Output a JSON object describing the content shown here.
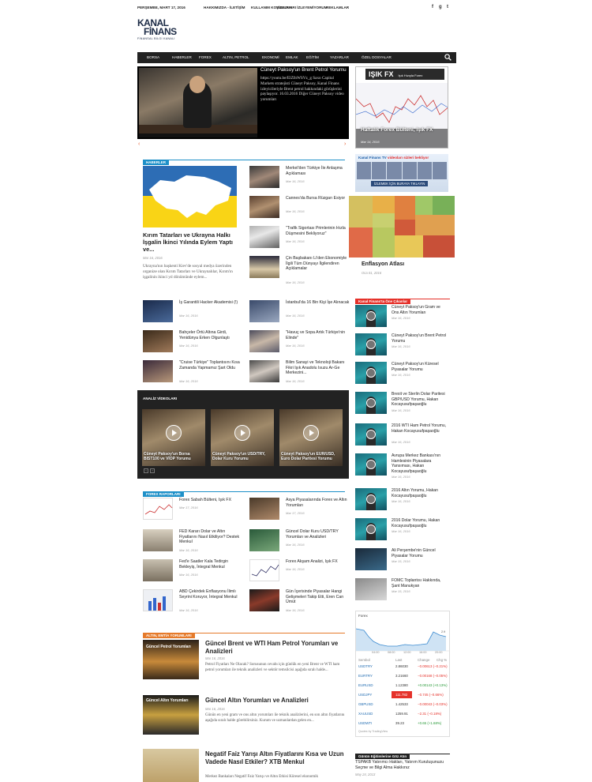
{
  "topbar": {
    "date": "PERŞEMBE, MART 17, 2016",
    "links": [
      "HAKKIMIZDA - İLETİŞİM",
      "KULLANIM KOŞULLARI",
      "VİDEOLARI İZLEYEMİYORUM",
      "REKLAMLAR"
    ]
  },
  "logo": {
    "line1": "KANAL",
    "line2": "FİNANS",
    "tagline": "FİNANSAL BİLGİ KANALI"
  },
  "nav": {
    "items": [
      "BORSA",
      "HABERLER",
      "FOREX",
      "ALTIN, PETROL",
      "EKONOMİ",
      "EMLAK",
      "EĞİTİM",
      "YAZARLAR",
      "ÖZEL DOSYALAR"
    ]
  },
  "slider": {
    "title": "Cüneyt Paksoy'un Brent Petrol Yorumu",
    "excerpt": "https://youtu.be/ElZfnWSVz_g Saxo Capital Markets stratejisti Cüneyt Paksoy, Kanal Finans izleyicileriyle Brent petrol hakkındaki görüşlerini paylaşıyor. 16.03.2016 Diğer Cüneyt Paksoy video yorumları"
  },
  "sidebar_top": {
    "fx_logo": "IŞIK FX",
    "fx_tag": "Işık Hızıyla Forex",
    "fx_caption": "Haftalık Forex Bülteni, Işık FX",
    "fx_date": "Mar 14, 2016",
    "promo_head_1": "Kanal Finans TV",
    "promo_head_2": "videoları sizleri bekliyor",
    "promo_cta": "İZLEMEK İÇİN BURAYA TIKLAYIN",
    "treemap_title": "Enflasyon Atlası",
    "treemap_date": "Oca 01, 2016"
  },
  "news": {
    "label": "HABERLER",
    "big_img_tag": "ukraine",
    "big_title": "Kırım Tatarları ve Ukrayna Halkı İşgalin İkinci Yılında Eylem Yaptı ve...",
    "big_date": "Mar 16, 2016",
    "big_excerpt": "Ukrayna'nın başkenti Kiev'de sosyal medya üzerinden organize olan Kırım Tatarları ve Ukraynalılar, Kırım'ın işgalinin ikinci yıl dönümünde eylem...",
    "right": [
      {
        "title": "Merkel'den Türkiye İle Anlaşma Açıklaması",
        "date": "Mar 16, 2016"
      },
      {
        "title": "Cannes'da Bursa Rüzgarı Esiyor",
        "date": "Mar 16, 2016"
      },
      {
        "title": "\"Trafik Sigortası Primlerinin Hızla Düşmesini Bekliyoruz\"",
        "date": "Mar 16, 2016"
      },
      {
        "title": "Çin Başbakanı Li'den Ekonomiyle İlgili Tüm Dünyayı İlgilendiren Açıklamalar",
        "date": "Mar 16, 2016"
      }
    ],
    "grid": [
      {
        "title": "İş Garantili Hacker Akademisi (!)",
        "date": "Mar 16, 2016"
      },
      {
        "title": "İstanbul'da 16 Bin Kişi İşe Alınacak",
        "date": "Mar 16, 2016"
      },
      {
        "title": "Bahçeler Örtü Altına Girdi, Yenidünya Erken Olgunlaştı",
        "date": "Mar 16, 2016"
      },
      {
        "title": "\"Havuç ve Sopa Artık Türkiye'nin Elinde\"",
        "date": "Mar 16, 2016"
      },
      {
        "title": "\"Cruise Türkiye\" Toplantısını Kısa Zamanda Yapmamız Şart Oldu",
        "date": "Mar 16, 2016"
      },
      {
        "title": "Bilim Sanayi ve Teknoloji Bakanı Fikri Işık Anadolu Isuzu Ar-Ge Merkezini...",
        "date": "Mar 16, 2016"
      }
    ]
  },
  "videos": {
    "label": "ANALİZ VİDEOLARI",
    "items": [
      "Cüneyt Paksoy'un Borsa BIST100 ve VİOP Yorumu",
      "Cüneyt Paksoy'un USD/TRY, Dolar Kuru Yorumu",
      "Cüneyt Paksoy'un EUR/USD, Euro Dolar Paritesi Yorumu"
    ],
    "prev": "‹",
    "next": "›"
  },
  "forex": {
    "label": "FOREX RAPORLARI",
    "items": [
      {
        "title": "Forex Sabah Bülteni, Işık FX",
        "date": "Mar 17, 2016"
      },
      {
        "title": "Asya Piyasalarında Forex ve Altın Yorumları",
        "date": "Mar 17, 2016"
      },
      {
        "title": "FED Kararı Dolar ve Altın Fiyatlarını Nasıl Etkiliyor? Destek Menkul",
        "date": "Mar 16, 2016"
      },
      {
        "title": "Güncel Dolar Kuru USD/TRY Yorumları ve Analizleri",
        "date": "Mar 16, 2016"
      },
      {
        "title": "Fed'e Saatler Kala Tedirgin Bekleyiş, İntegral Menkul",
        "date": "Mar 16, 2016"
      },
      {
        "title": "Forex Akşam Analizi, Işık FX",
        "date": "Mar 16, 2016"
      },
      {
        "title": "ABD Çekirdek Enflasyonu İlimlı Seyrini Koruyor, İntegral Menkul",
        "date": "Mar 16, 2016"
      },
      {
        "title": "Gün İçerisinde Piyasalar Hangi Gelişmeleri Takip Etti, Eren Can Ümüt",
        "date": "Mar 16, 2016"
      }
    ]
  },
  "gold": {
    "label": "ALTIN, EMTİA YORUMLARI",
    "articles": [
      {
        "img": "Güncel Petrol Yorumları",
        "title": "Güncel Brent ve WTI Ham Petrol Yorumları ve Analizleri",
        "date": "Mar 16, 2016",
        "excerpt": "Petrol Fiyatları Ne Olacak? Sorusunun cevabı için günlük en yeni Brent ve WTI ham petrol yorumları ile teknik analizleri ve sektör temsilcisi aşağıda sıralı halde..."
      },
      {
        "img": "Güncel Altın Yorumları",
        "title": "Güncel Altın Yorumları ve Analizleri",
        "date": "Mar 16, 2016",
        "excerpt": "Günün en yeni gram ve ons altın yorumları ile teknik analizlerini, en son altın fiyatlarını aşağıda sıralı halde görebilirsiniz. Kurum ve uzmanlardan gelen en..."
      },
      {
        "img": "",
        "title": "Negatif Faiz Yarışı Altın Fiyatlarını Kısa ve Uzun Vadede Nasıl Etkiler? XTB Menkul",
        "date": "",
        "excerpt": "Merkez Bankaları Negatif Faiz Yarışı ve Altın Etkisi Küresel ekonomik"
      }
    ]
  },
  "featured": {
    "label": "Kanal Finans'ta Öne Çıkanlar",
    "items": [
      {
        "title": "Cüneyt Paksoy'un Gram ve Ons Altın Yorumları",
        "date": "Mar 16, 2016"
      },
      {
        "title": "Cüneyt Paksoy'un Brent Petrol Yorumu",
        "date": "Mar 16, 2016"
      },
      {
        "title": "Cüneyt Paksoy'un Küresel Piyasalar Yorumu",
        "date": "Mar 16, 2016"
      },
      {
        "title": "Brexit ve Sterlin Dolar Paritesi GBP/USD Yorumu, Hakan Kocayusufpaşaoğlu",
        "date": "Mar 16, 2016"
      },
      {
        "title": "2016 WTI Ham Petrol Yorumu, Hakan Kocayusufpaşaoğlu",
        "date": "Mar 16, 2016"
      },
      {
        "title": "Avrupa Merkez Bankası'nın Hamlesinin Piyasalara Yansıması, Hakan Kocayusufpaşaoğlu",
        "date": "Mar 16, 2016"
      },
      {
        "title": "2016 Altın Yorumu, Hakan Kocayusufpaşaoğlu",
        "date": "Mar 16, 2016"
      },
      {
        "title": "2016 Dolar Yorumu, Hakan Kocayusufpaşaoğlu",
        "date": "Mar 16, 2016"
      },
      {
        "title": "Ali Perşembe'nin Güncel Piyasalar Yorumu",
        "date": "Mar 15, 2016"
      },
      {
        "title": "FOMC Toplantısı Hakkında, Şant Manukyan",
        "date": "Mar 15, 2016"
      }
    ]
  },
  "fx_widget": {
    "header": "Forex",
    "ylabel_top": "2.9",
    "times": [
      "04:00",
      "08:00",
      "12:00",
      "16:00",
      "20:00"
    ],
    "cols": [
      "Sembol",
      "Last",
      "Change",
      "Chg %"
    ],
    "rows": [
      {
        "s": "USDTRY",
        "l": "2.86030",
        "c": "−0.00613 (−0.21%)",
        "up": false
      },
      {
        "s": "EURTRY",
        "l": "3.21660",
        "c": "−0.00168 (−0.05%)",
        "up": false
      },
      {
        "s": "EURUSD",
        "l": "1.12380",
        "c": "+0.00143 (+0.13%)",
        "up": true
      },
      {
        "s": "USDJPY",
        "l": "111.782",
        "c": "−0.745 (−0.66%)",
        "up": false
      },
      {
        "s": "GBPUSD",
        "l": "1.42533",
        "c": "−0.00043 (−0.03%)",
        "up": false
      },
      {
        "s": "XAUUSD",
        "l": "1259.91",
        "c": "−2.31 (−0.18%)",
        "up": false
      },
      {
        "s": "USDWTI",
        "l": "39.23",
        "c": "+0.65 (+1.68%)",
        "up": true
      }
    ],
    "credit": "Quotes by TradingView"
  },
  "education": {
    "label": "Günün Eğitimlerine Göz Atın",
    "title": "TSPAKB Yatırımcı Hakları, Yatırım Kuruluşunuzu Seçme ve Bilgi Alma Hakkınız",
    "date": "May 24, 2013"
  },
  "colors": {
    "accent": "#e5312a",
    "blue": "#1e90c8",
    "orange": "#e57a2a",
    "dark": "#222222"
  }
}
